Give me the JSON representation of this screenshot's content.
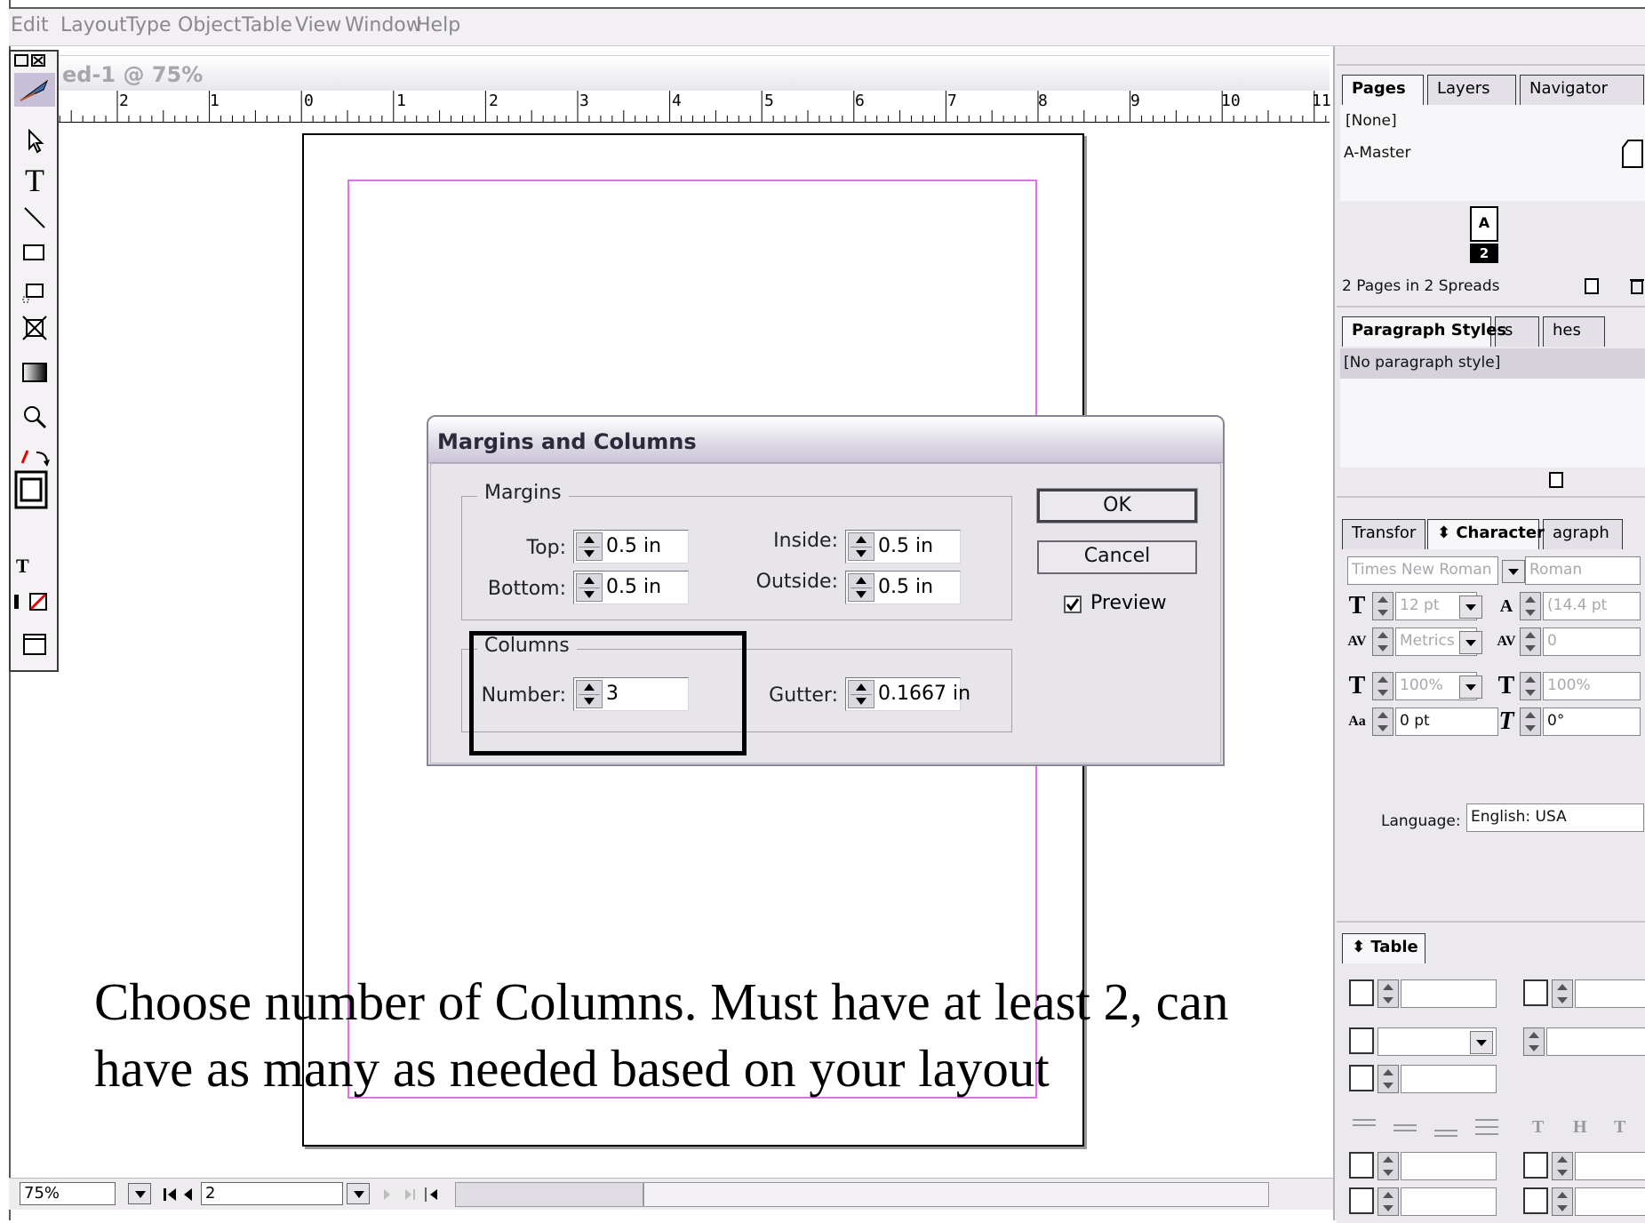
{
  "menubar": {
    "items": [
      "Edit",
      "Layout",
      "Type",
      "Object",
      "Table",
      "View",
      "Window",
      "Help"
    ]
  },
  "document": {
    "title": "ed-1 @ 75%",
    "ruler_numbers": [
      "2",
      "1",
      "0",
      "1",
      "2",
      "3",
      "4",
      "5",
      "6",
      "7",
      "8",
      "9",
      "10",
      "11"
    ]
  },
  "toolbox": {
    "tools": [
      "selection-arrow-icon",
      "type-tool-icon",
      "line-tool-icon",
      "rectangle-tool-icon",
      "frame-tool-icon",
      "free-transform-icon",
      "gradient-icon",
      "zoom-icon",
      "swap-colors-icon",
      "fill-stroke-icon",
      "text-format-icon",
      "none-color-icon",
      "view-mode-icon"
    ],
    "type_glyph": "T",
    "text_glyph": "T"
  },
  "dialog": {
    "title": "Margins and Columns",
    "margins_legend": "Margins",
    "top_label": "Top:",
    "top_value": "0.5 in",
    "bottom_label": "Bottom:",
    "bottom_value": "0.5 in",
    "inside_label": "Inside:",
    "inside_value": "0.5 in",
    "outside_label": "Outside:",
    "outside_value": "0.5 in",
    "columns_legend": "Columns",
    "number_label": "Number:",
    "number_value": "3",
    "gutter_label": "Gutter:",
    "gutter_value": "0.1667 in",
    "ok_label": "OK",
    "cancel_label": "Cancel",
    "preview_label": "Preview",
    "preview_checked": true
  },
  "caption": {
    "line1": "Choose number of Columns.  Must have at least 2, can",
    "line2": "have as many as needed based on your layout"
  },
  "statusbar": {
    "zoom": "75%",
    "page": "2"
  },
  "pages_panel": {
    "tabs": [
      "Pages",
      "Layers",
      "Navigator"
    ],
    "items": [
      "[None]",
      "A-Master"
    ],
    "master_letter": "A",
    "page_number": "2",
    "footer": "2 Pages in 2 Spreads"
  },
  "paragraph_styles_panel": {
    "tabs": [
      "Paragraph Styles",
      "s",
      "hes"
    ],
    "items": [
      "[No paragraph style]"
    ]
  },
  "character_panel": {
    "tabs": [
      "Transfor",
      "⬍ Character",
      "agraph"
    ],
    "font_family": "Times New Roman PS",
    "font_style": "Roman",
    "size": "12 pt",
    "leading": "(14.4 pt",
    "kerning": "Metrics",
    "tracking": "0",
    "vscale": "100%",
    "hscale": "100%",
    "baseline": "0 pt",
    "skew": "0°",
    "language_label": "Language:",
    "language_value": "English: USA"
  },
  "table_panel": {
    "tab": "⬍ Table"
  },
  "colors": {
    "margin_guide": "#e070e8",
    "panel_bg": "#ebe9ee",
    "dialog_bg": "#e7e4ea"
  }
}
